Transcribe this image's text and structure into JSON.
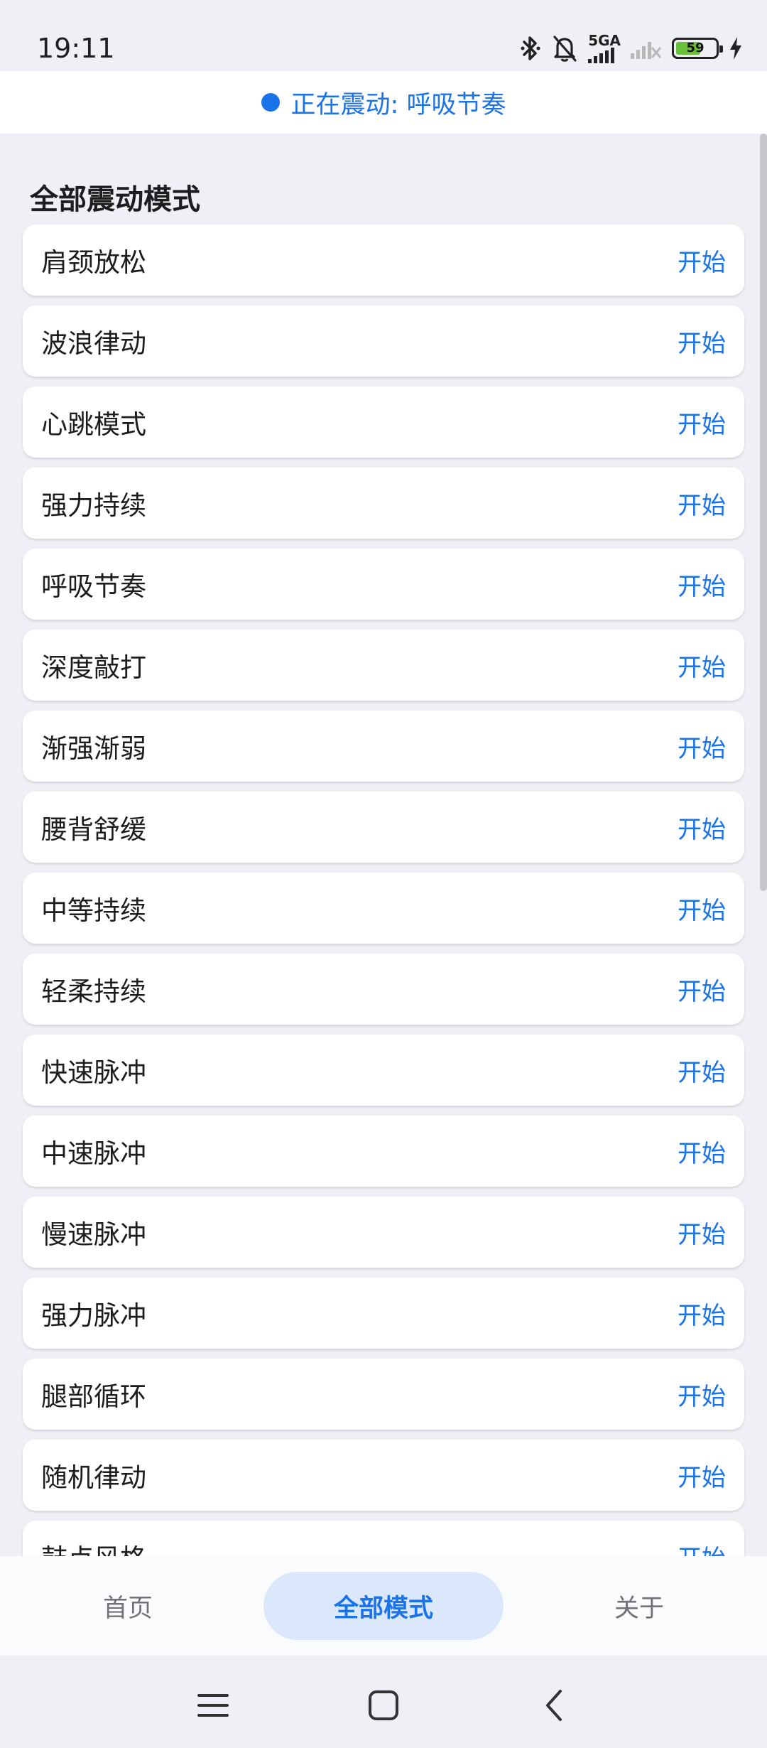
{
  "status_bar": {
    "time": "19:11",
    "network": "5GA",
    "battery": "59"
  },
  "now_playing": {
    "text": "正在震动: 呼吸节奏"
  },
  "section_title": "全部震动模式",
  "modes": [
    {
      "name": "肩颈放松",
      "action": "开始"
    },
    {
      "name": "波浪律动",
      "action": "开始"
    },
    {
      "name": "心跳模式",
      "action": "开始"
    },
    {
      "name": "强力持续",
      "action": "开始"
    },
    {
      "name": "呼吸节奏",
      "action": "开始"
    },
    {
      "name": "深度敲打",
      "action": "开始"
    },
    {
      "name": "渐强渐弱",
      "action": "开始"
    },
    {
      "name": "腰背舒缓",
      "action": "开始"
    },
    {
      "name": "中等持续",
      "action": "开始"
    },
    {
      "name": "轻柔持续",
      "action": "开始"
    },
    {
      "name": "快速脉冲",
      "action": "开始"
    },
    {
      "name": "中速脉冲",
      "action": "开始"
    },
    {
      "name": "慢速脉冲",
      "action": "开始"
    },
    {
      "name": "强力脉冲",
      "action": "开始"
    },
    {
      "name": "腿部循环",
      "action": "开始"
    },
    {
      "name": "随机律动",
      "action": "开始"
    },
    {
      "name": "鼓点风格",
      "action": "开始"
    }
  ],
  "bottom_nav": {
    "tabs": [
      {
        "label": "首页",
        "active": false
      },
      {
        "label": "全部模式",
        "active": true
      },
      {
        "label": "关于",
        "active": false
      }
    ]
  },
  "colors": {
    "accent": "#1a73e8",
    "background": "#eef0f5",
    "active_tab_bg": "#dbe8fb"
  }
}
